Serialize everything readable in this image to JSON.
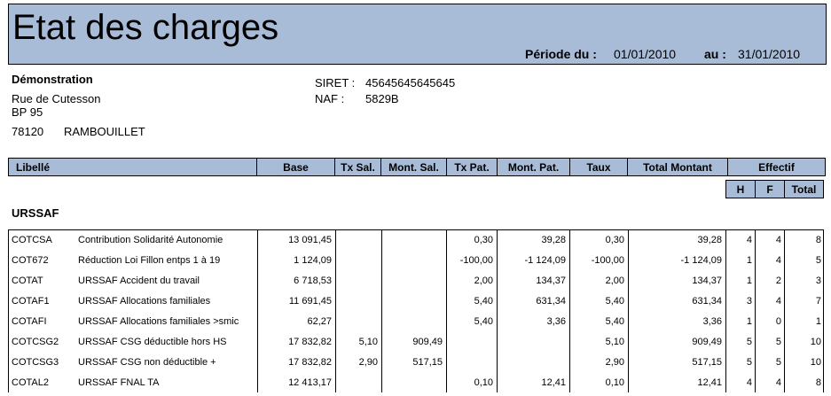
{
  "title": "Etat des charges",
  "period": {
    "from_label": "Période du :",
    "from": "01/01/2010",
    "to_label": "au :",
    "to": "31/01/2010"
  },
  "company": {
    "name": "Démonstration",
    "street": "Rue de Cutesson",
    "bp": "BP 95",
    "postcode": "78120",
    "city": "RAMBOUILLET",
    "siret_label": "SIRET :",
    "siret": "45645645645645",
    "naf_label": "NAF :",
    "naf": "5829B"
  },
  "columns": {
    "libelle": "Libellé",
    "base": "Base",
    "tx_sal": "Tx Sal.",
    "mont_sal": "Mont. Sal.",
    "tx_pat": "Tx Pat.",
    "mont_pat": "Mont. Pat.",
    "taux": "Taux",
    "total": "Total Montant",
    "effectif": "Effectif",
    "h": "H",
    "f": "F",
    "eff_total": "Total"
  },
  "section": "URSSAF",
  "rows": [
    {
      "code": "COTCSA",
      "label": "Contribution Solidarité Autonomie",
      "base": "13 091,45",
      "tx_sal": "",
      "mont_sal": "",
      "tx_pat": "0,30",
      "mont_pat": "39,28",
      "taux": "0,30",
      "total": "39,28",
      "h": "4",
      "f": "4",
      "t": "8"
    },
    {
      "code": "COT672",
      "label": "Réduction Loi Fillon entps 1 à 19",
      "base": "1 124,09",
      "tx_sal": "",
      "mont_sal": "",
      "tx_pat": "-100,00",
      "mont_pat": "-1 124,09",
      "taux": "-100,00",
      "total": "-1 124,09",
      "h": "1",
      "f": "4",
      "t": "5"
    },
    {
      "code": "COTAT",
      "label": "URSSAF Accident du travail",
      "base": "6 718,53",
      "tx_sal": "",
      "mont_sal": "",
      "tx_pat": "2,00",
      "mont_pat": "134,37",
      "taux": "2,00",
      "total": "134,37",
      "h": "1",
      "f": "2",
      "t": "3"
    },
    {
      "code": "COTAF1",
      "label": "URSSAF Allocations familiales",
      "base": "11 691,45",
      "tx_sal": "",
      "mont_sal": "",
      "tx_pat": "5,40",
      "mont_pat": "631,34",
      "taux": "5,40",
      "total": "631,34",
      "h": "3",
      "f": "4",
      "t": "7"
    },
    {
      "code": "COTAFI",
      "label": "URSSAF Allocations familiales >smic",
      "base": "62,27",
      "tx_sal": "",
      "mont_sal": "",
      "tx_pat": "5,40",
      "mont_pat": "3,36",
      "taux": "5,40",
      "total": "3,36",
      "h": "1",
      "f": "0",
      "t": "1"
    },
    {
      "code": "COTCSG2",
      "label": "URSSAF CSG déductible hors HS",
      "base": "17 832,82",
      "tx_sal": "5,10",
      "mont_sal": "909,49",
      "tx_pat": "",
      "mont_pat": "",
      "taux": "5,10",
      "total": "909,49",
      "h": "5",
      "f": "5",
      "t": "10"
    },
    {
      "code": "COTCSG3",
      "label": "URSSAF CSG non déductible +",
      "base": "17 832,82",
      "tx_sal": "2,90",
      "mont_sal": "517,15",
      "tx_pat": "",
      "mont_pat": "",
      "taux": "2,90",
      "total": "517,15",
      "h": "5",
      "f": "5",
      "t": "10"
    },
    {
      "code": "COTAL2",
      "label": "URSSAF FNAL TA",
      "base": "12 413,17",
      "tx_sal": "",
      "mont_sal": "",
      "tx_pat": "0,10",
      "mont_pat": "12,41",
      "taux": "0,10",
      "total": "12,41",
      "h": "4",
      "f": "4",
      "t": "8"
    }
  ]
}
